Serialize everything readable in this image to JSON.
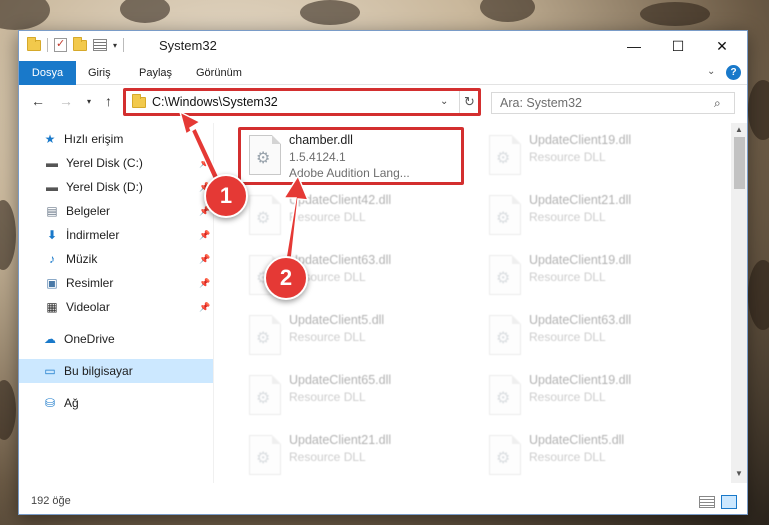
{
  "window": {
    "title": "System32",
    "controls": {
      "minimize": "—",
      "maximize": "☐",
      "close": "✕"
    }
  },
  "ribbon": {
    "tabs": [
      "Dosya",
      "Giriş",
      "Paylaş",
      "Görünüm"
    ]
  },
  "navigation": {
    "back": "←",
    "forward": "→",
    "recent": "▾",
    "up": "↑",
    "address": "C:\\Windows\\System32",
    "search_placeholder": "Ara: System32"
  },
  "sidebar": {
    "items": [
      {
        "label": "Hızlı erişim",
        "icon": "star-icon"
      },
      {
        "label": "Yerel Disk (C:)",
        "icon": "drive-icon",
        "pinned": true
      },
      {
        "label": "Yerel Disk (D:)",
        "icon": "drive-icon",
        "pinned": true
      },
      {
        "label": "Belgeler",
        "icon": "documents-icon",
        "pinned": true
      },
      {
        "label": "İndirmeler",
        "icon": "download-icon",
        "pinned": true
      },
      {
        "label": "Müzik",
        "icon": "music-icon",
        "pinned": true
      },
      {
        "label": "Resimler",
        "icon": "pictures-icon",
        "pinned": true
      },
      {
        "label": "Videolar",
        "icon": "videos-icon",
        "pinned": true
      },
      {
        "label": "OneDrive",
        "icon": "cloud-icon"
      },
      {
        "label": "Bu bilgisayar",
        "icon": "computer-icon",
        "selected": true
      },
      {
        "label": "Ağ",
        "icon": "network-icon"
      }
    ]
  },
  "files": [
    {
      "name": "chamber.dll",
      "line1": "1.5.4124.1",
      "line2": "Adobe Audition Lang...",
      "highlighted": true
    },
    {
      "name": "UpdateClient19.dll",
      "line1": "Resource DLL",
      "line2": ""
    },
    {
      "name": "UpdateClient42.dll",
      "line1": "Resource DLL",
      "line2": ""
    },
    {
      "name": "UpdateClient21.dll",
      "line1": "Resource DLL",
      "line2": ""
    },
    {
      "name": "UpdateClient63.dll",
      "line1": "Resource DLL",
      "line2": ""
    },
    {
      "name": "UpdateClient19.dll",
      "line1": "Resource DLL",
      "line2": ""
    },
    {
      "name": "UpdateClient5.dll",
      "line1": "Resource DLL",
      "line2": ""
    },
    {
      "name": "UpdateClient63.dll",
      "line1": "Resource DLL",
      "line2": ""
    },
    {
      "name": "UpdateClient65.dll",
      "line1": "Resource DLL",
      "line2": ""
    },
    {
      "name": "UpdateClient19.dll",
      "line1": "Resource DLL",
      "line2": ""
    },
    {
      "name": "UpdateClient21.dll",
      "line1": "Resource DLL",
      "line2": ""
    },
    {
      "name": "UpdateClient5.dll",
      "line1": "Resource DLL",
      "line2": ""
    }
  ],
  "status": {
    "count": "192 öğe"
  },
  "callouts": [
    "1",
    "2"
  ],
  "colors": {
    "accent": "#1979ca",
    "highlight": "#d32f2f",
    "callout": "#e53935",
    "selection": "#cce8ff"
  }
}
